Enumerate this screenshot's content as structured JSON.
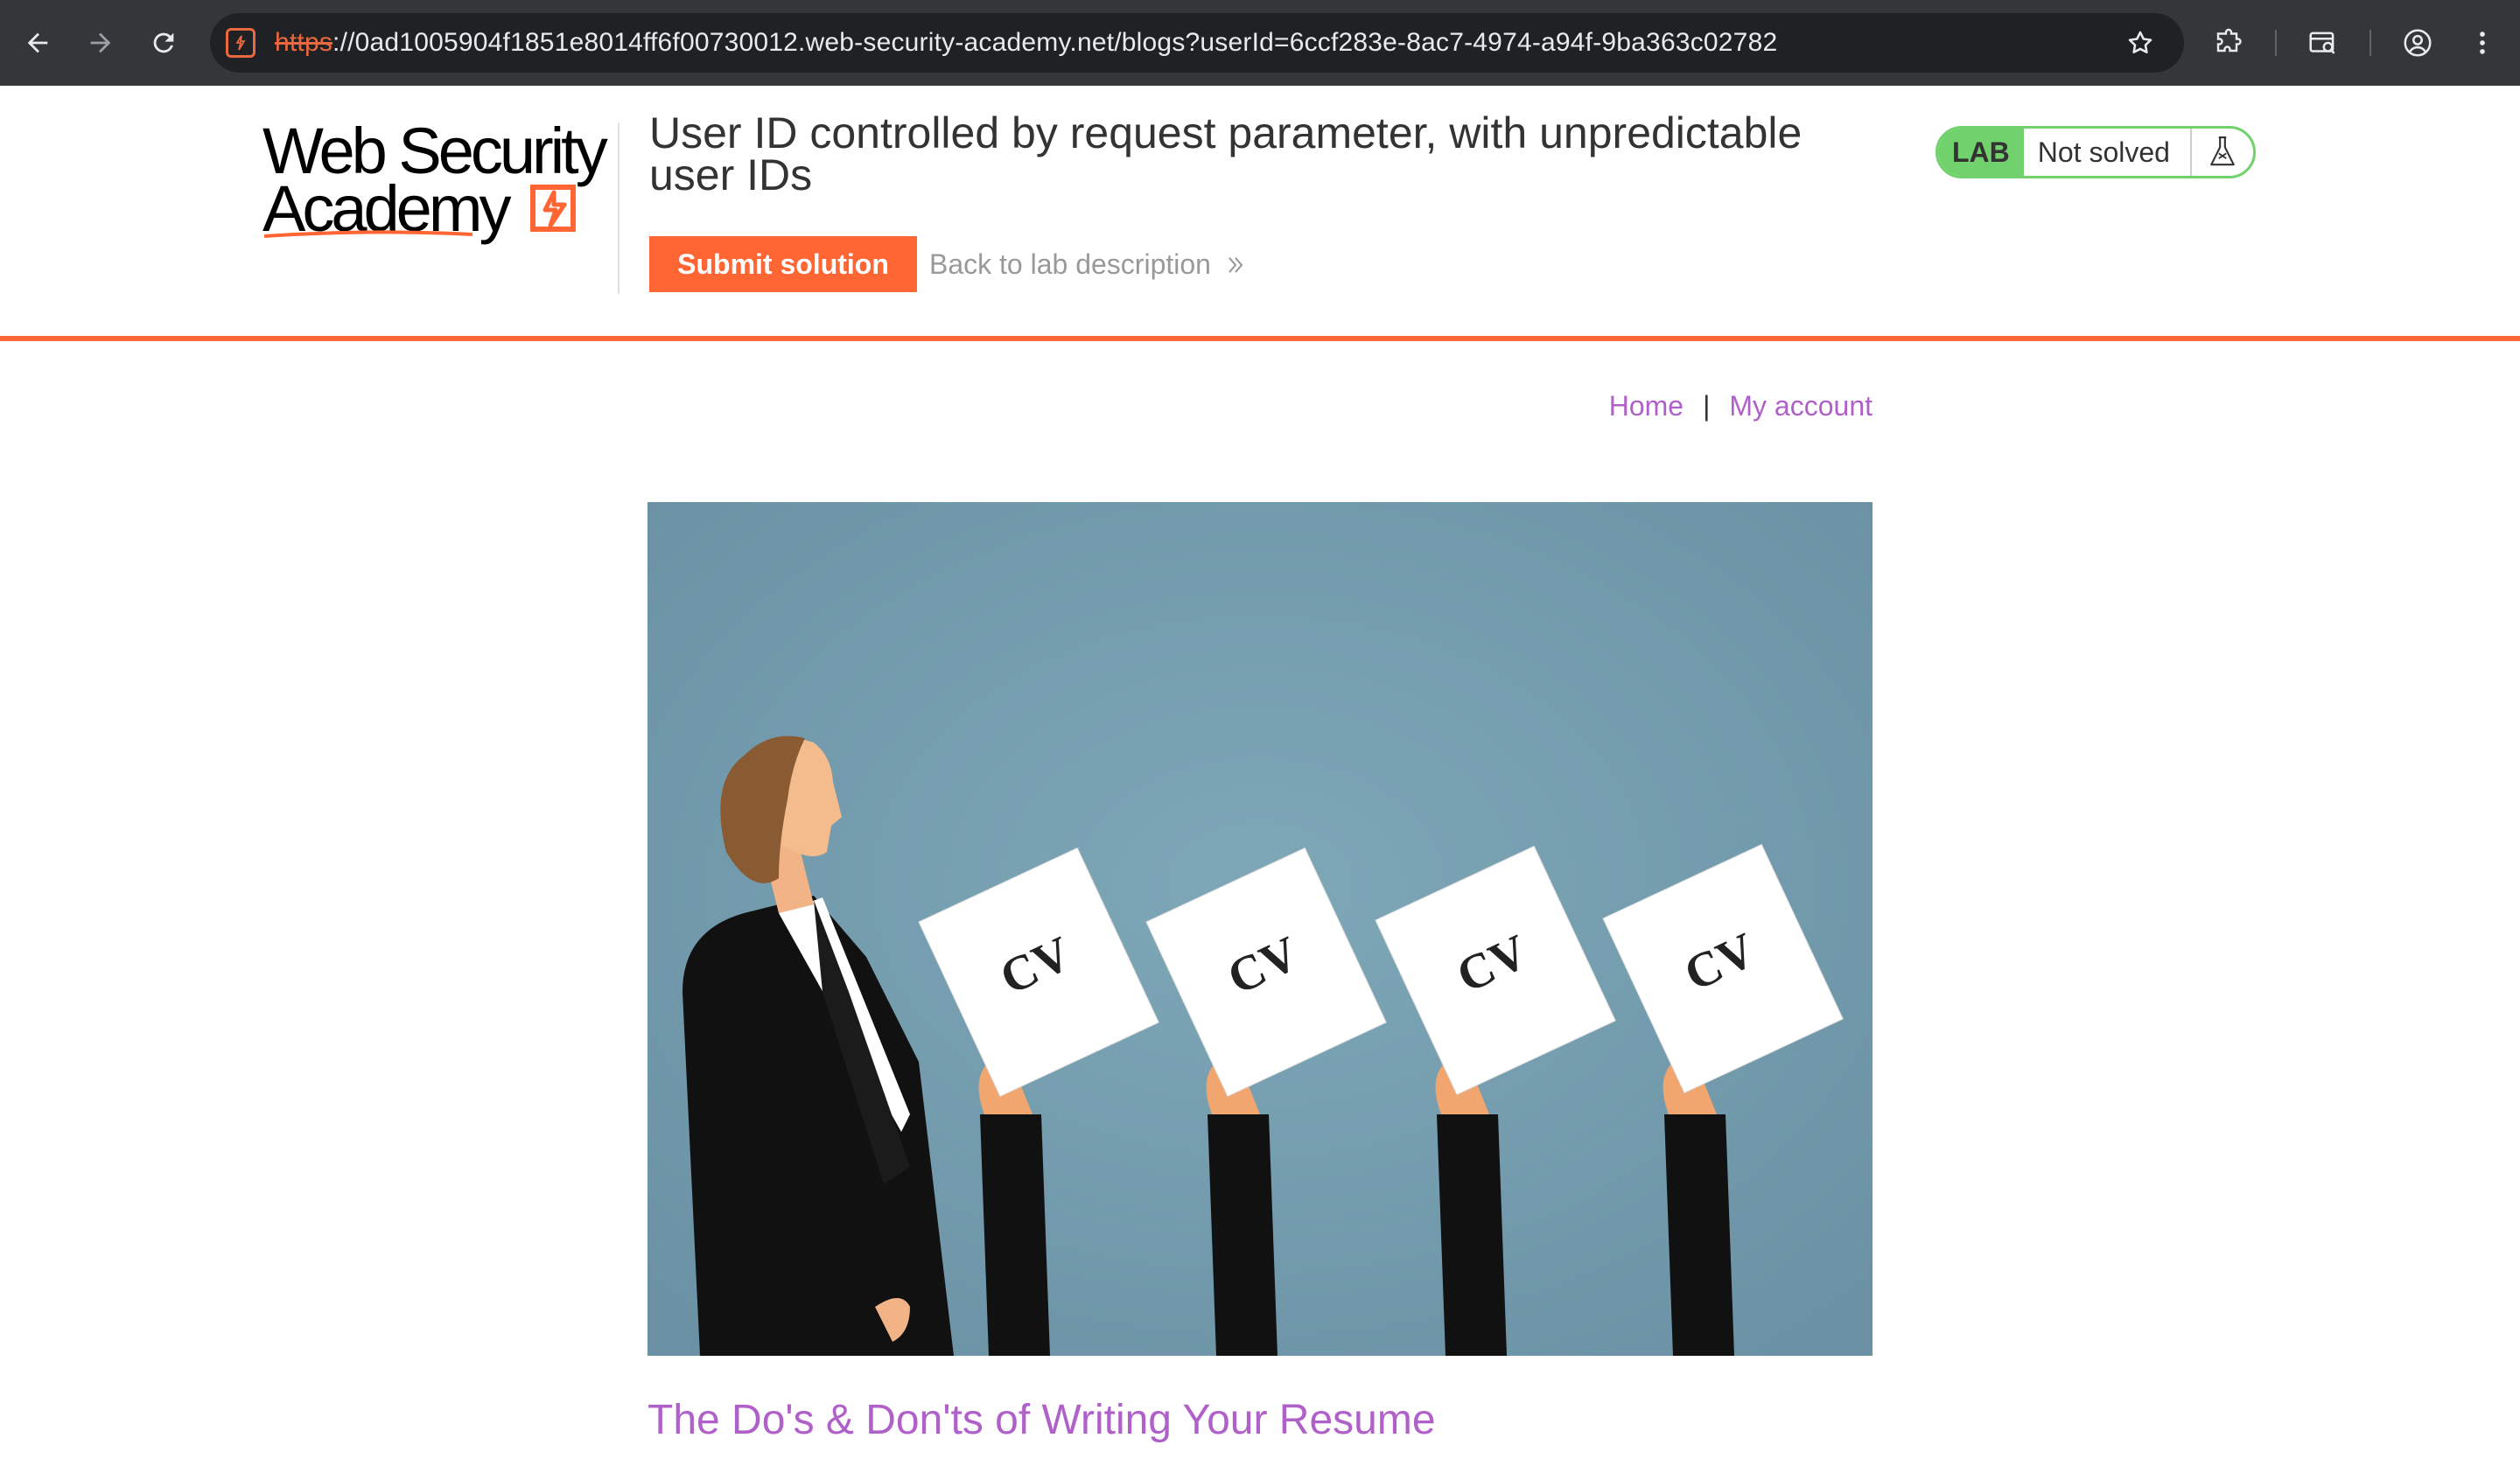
{
  "browser": {
    "url_scheme": "https",
    "url_rest": "://0ad1005904f1851e8014ff6f00730012.web-security-academy.net/blogs?userId=6ccf283e-8ac7-4974-a94f-9ba363c02782",
    "accent": "#e8683f"
  },
  "lab": {
    "logo_line1": "Web Security",
    "logo_line2": "Academy",
    "title": "User ID controlled by request parameter, with unpredictable user IDs",
    "submit_label": "Submit solution",
    "back_label": "Back to lab description",
    "badge_label": "LAB",
    "status": "Not solved",
    "accent": "#ff6633",
    "status_color": "#70d16d"
  },
  "nav": {
    "home": "Home",
    "separator": "|",
    "account": "My account"
  },
  "post": {
    "image_text": [
      "CV",
      "CV",
      "CV",
      "CV"
    ],
    "title": "The Do's & Don'ts of Writing Your Resume"
  }
}
